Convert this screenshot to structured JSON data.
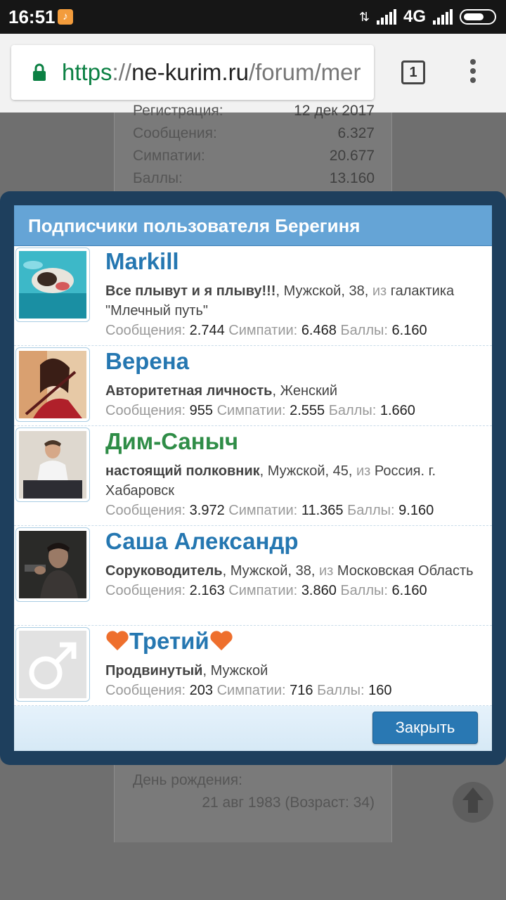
{
  "status_bar": {
    "time": "16:51",
    "network": "4G"
  },
  "browser": {
    "url_scheme": "https",
    "url_sep": "://",
    "url_host": "ne-kurim.ru",
    "url_path": "/forum/mer",
    "tab_count": "1"
  },
  "background_page": {
    "rows": [
      {
        "label": "Регистрация:",
        "value": "12 дек 2017"
      },
      {
        "label": "Сообщения:",
        "value": "6.327"
      },
      {
        "label": "Симпатии:",
        "value": "20.677"
      },
      {
        "label": "Баллы:",
        "value": "13.160"
      }
    ],
    "birthday_label": "День рождения:",
    "birthday_value": "21 авг 1983 (Возраст: 34)"
  },
  "dialog": {
    "title": "Подписчики пользователя Берегиня",
    "close_label": "Закрыть",
    "labels": {
      "messages": "Сообщения:",
      "likes": "Симпатии:",
      "points": "Баллы:",
      "from": "из"
    },
    "members": [
      {
        "name": "Markill",
        "title": "Все плывут и я плыву!!!",
        "gender": ", Мужской, 38, ",
        "location": "галактика \"Млечный путь\"",
        "messages": "2.744",
        "likes": "6.468",
        "points": "6.160"
      },
      {
        "name": "Верена",
        "title": "Авторитетная личность",
        "gender": ", Женский",
        "location": "",
        "messages": "955",
        "likes": "2.555",
        "points": "1.660"
      },
      {
        "name": "Дим-Саныч",
        "title": "настоящий полковник",
        "gender": ", Мужской, 45, ",
        "location": "Россия. г. Хабаровск",
        "messages": "3.972",
        "likes": "11.365",
        "points": "9.160"
      },
      {
        "name": "Саша Александр",
        "title": "Соруководитель",
        "gender": ", Мужской, 38, ",
        "location": "Московская Область",
        "messages": "2.163",
        "likes": "3.860",
        "points": "6.160"
      },
      {
        "name": "Третий",
        "title": "Продвинутый",
        "gender": ", Мужской",
        "location": "",
        "messages": "203",
        "likes": "716",
        "points": "160"
      }
    ]
  }
}
